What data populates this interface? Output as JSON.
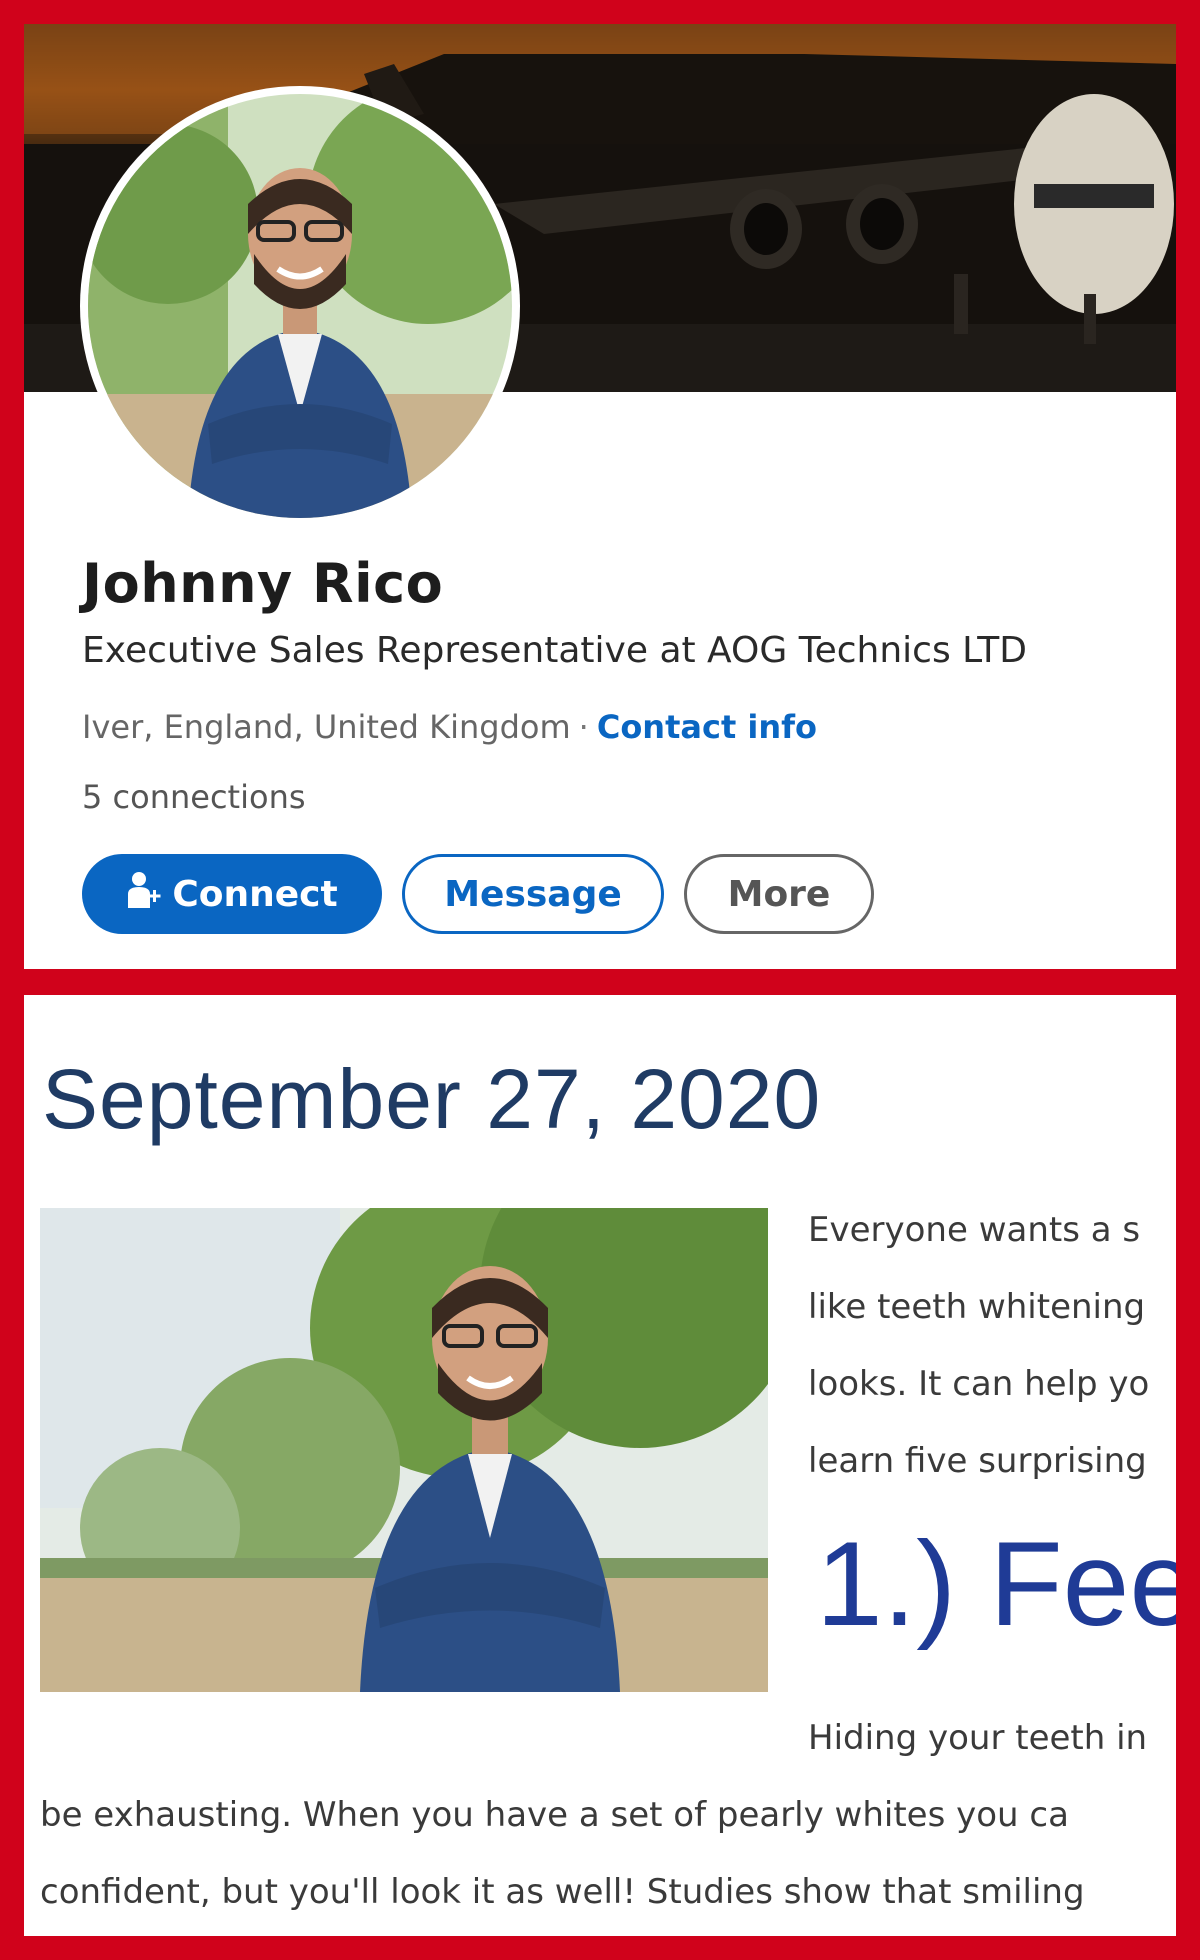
{
  "profile": {
    "name": "Johnny Rico",
    "headline": "Executive Sales Representative at AOG Technics LTD",
    "location": "Iver, England, United Kingdom",
    "separator": "·",
    "contact_info": "Contact info",
    "connections": "5 connections",
    "buttons": {
      "connect": "Connect",
      "message": "Message",
      "more": "More"
    },
    "colors": {
      "accent": "#0a66c2"
    }
  },
  "blog": {
    "date": "September 27, 2020",
    "lines_right": [
      "Everyone wants a s",
      "like teeth whitening",
      "looks. It can help yo",
      "learn five surprising"
    ],
    "heading": "1.) Fee",
    "line_after_heading": "Hiding your teeth in",
    "lines_full": [
      "be exhausting. When you have a set of pearly whites you ca",
      "confident, but you'll look it as well! Studies show that smiling"
    ],
    "colors": {
      "date": "#1f3b64",
      "heading": "#1f3b96"
    }
  },
  "frame": {
    "border_color": "#d0021b"
  }
}
